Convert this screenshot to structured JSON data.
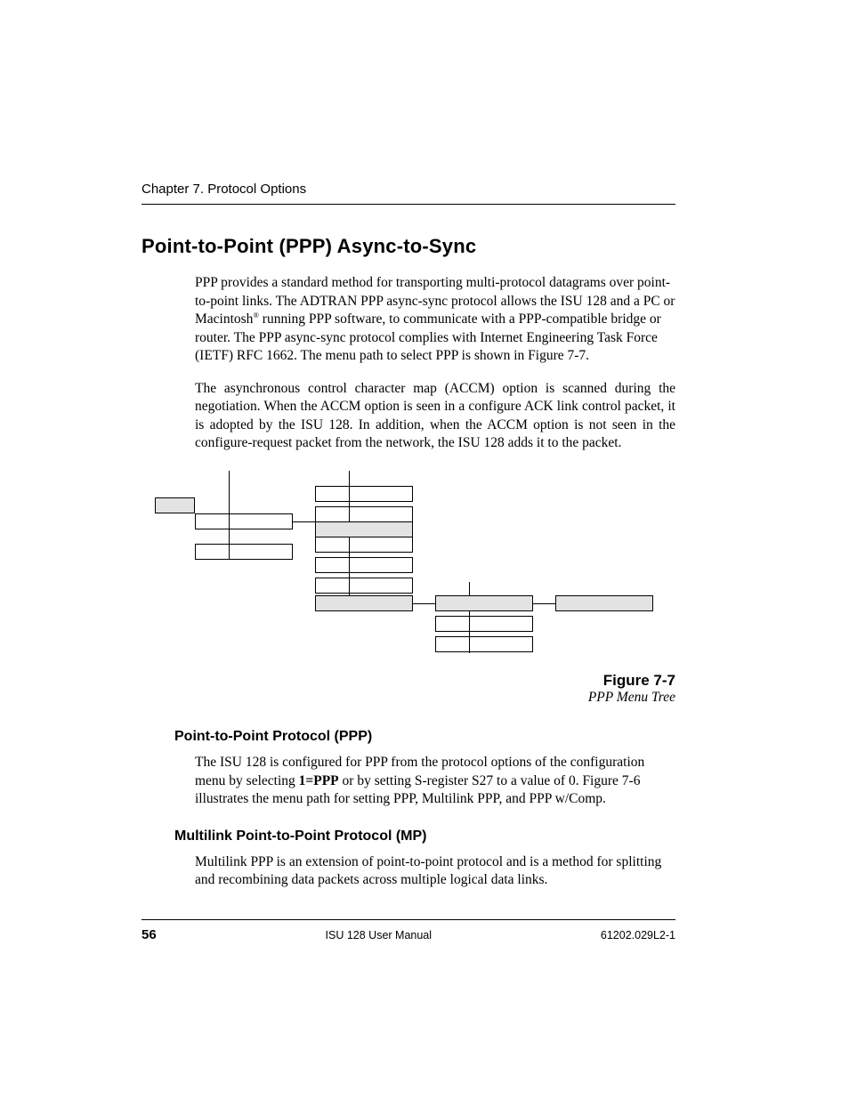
{
  "header": {
    "running": "Chapter 7. Protocol Options"
  },
  "h1": "Point-to-Point (PPP) Async-to-Sync",
  "p1a": "PPP provides a standard method for transporting multi-protocol datagrams over point-to-point links.  The ADTRAN PPP async-sync protocol allows the ISU 128 and a PC or Macintosh",
  "p1b": " running PPP software, to communicate with a PPP-compatible bridge or router.  The PPP async-sync protocol complies with Internet Engineering Task Force (IETF) RFC 1662.  The menu path to select PPP is shown in Figure 7-7.",
  "p2": "The asynchronous control character map (ACCM) option is scanned during the negotiation.  When the ACCM option is seen in a configure ACK link control packet, it is adopted by the ISU 128.  In addition, when the ACCM option is not seen in the configure-request packet from the network, the ISU 128 adds it to the packet.",
  "fig": {
    "num": "Figure 7-7",
    "title": "PPP Menu Tree"
  },
  "h3a": "Point-to-Point Protocol (PPP)",
  "p3a": "The ISU 128 is configured for PPP from the protocol options of the configuration menu by selecting ",
  "p3bold": "1=PPP",
  "p3b": " or by setting S-register S27 to a value of 0.  Figure 7-6 illustrates the menu path for setting PPP, Multilink PPP, and PPP w/Comp.",
  "h3b": "Multilink Point-to-Point Protocol (MP)",
  "p4": "Multilink PPP is an extension of point-to-point protocol and is a method for splitting and recombining data packets across multiple logical data links.",
  "footer": {
    "page": "56",
    "center": "ISU 128 User Manual",
    "right": "61202.029L2-1"
  }
}
